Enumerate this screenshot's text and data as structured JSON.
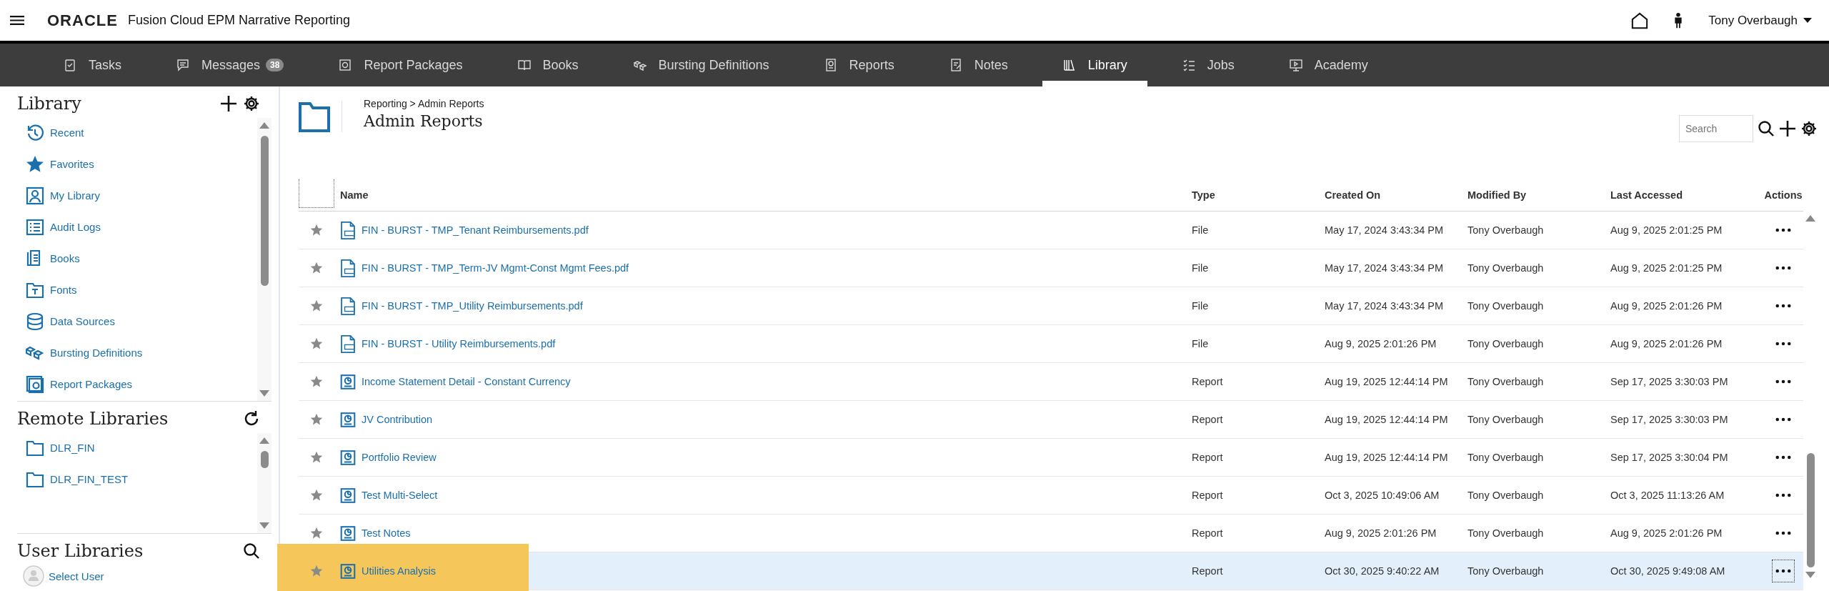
{
  "header": {
    "brand": "ORACLE",
    "product": "Fusion Cloud EPM Narrative Reporting",
    "user": "Tony Overbaugh"
  },
  "nav_tabs": [
    {
      "label": "Tasks",
      "selected": false
    },
    {
      "label": "Messages",
      "badge": "38",
      "selected": false
    },
    {
      "label": "Report Packages",
      "selected": false
    },
    {
      "label": "Books",
      "selected": false
    },
    {
      "label": "Bursting Definitions",
      "selected": false
    },
    {
      "label": "Reports",
      "selected": false
    },
    {
      "label": "Notes",
      "selected": false
    },
    {
      "label": "Library",
      "selected": true
    },
    {
      "label": "Jobs",
      "selected": false
    },
    {
      "label": "Academy",
      "selected": false
    }
  ],
  "sidebar": {
    "library_title": "Library",
    "items": [
      {
        "label": "Recent"
      },
      {
        "label": "Favorites"
      },
      {
        "label": "My Library"
      },
      {
        "label": "Audit Logs"
      },
      {
        "label": "Books"
      },
      {
        "label": "Fonts"
      },
      {
        "label": "Data Sources"
      },
      {
        "label": "Bursting Definitions"
      },
      {
        "label": "Report Packages"
      }
    ],
    "remote_title": "Remote Libraries",
    "remote_items": [
      {
        "label": "DLR_FIN"
      },
      {
        "label": "DLR_FIN_TEST"
      }
    ],
    "user_title": "User Libraries",
    "select_user": "Select User"
  },
  "content": {
    "breadcrumb": "Reporting > Admin Reports",
    "title": "Admin Reports",
    "search": {
      "placeholder": "Search"
    }
  },
  "table": {
    "columns": [
      "Name",
      "Type",
      "Created On",
      "Modified By",
      "Last Accessed",
      "Actions"
    ],
    "rows": [
      {
        "name": "FIN - BURST - TMP_Tenant Reimbursements.pdf",
        "kind": "pdf",
        "type": "File",
        "created": "May 17, 2024 3:43:34 PM",
        "modified_by": "Tony Overbaugh",
        "accessed": "Aug 9, 2025 2:01:25 PM",
        "selected": false,
        "highlighted": false
      },
      {
        "name": "FIN - BURST - TMP_Term-JV Mgmt-Const Mgmt Fees.pdf",
        "kind": "pdf",
        "type": "File",
        "created": "May 17, 2024 3:43:34 PM",
        "modified_by": "Tony Overbaugh",
        "accessed": "Aug 9, 2025 2:01:25 PM",
        "selected": false,
        "highlighted": false
      },
      {
        "name": "FIN - BURST - TMP_Utility Reimbursements.pdf",
        "kind": "pdf",
        "type": "File",
        "created": "May 17, 2024 3:43:34 PM",
        "modified_by": "Tony Overbaugh",
        "accessed": "Aug 9, 2025 2:01:26 PM",
        "selected": false,
        "highlighted": false
      },
      {
        "name": "FIN - BURST - Utility Reimbursements.pdf",
        "kind": "pdf",
        "type": "File",
        "created": "Aug 9, 2025 2:01:26 PM",
        "modified_by": "Tony Overbaugh",
        "accessed": "Aug 9, 2025 2:01:26 PM",
        "selected": false,
        "highlighted": false
      },
      {
        "name": "Income Statement Detail - Constant Currency",
        "kind": "report",
        "type": "Report",
        "created": "Aug 19, 2025 12:44:14 PM",
        "modified_by": "Tony Overbaugh",
        "accessed": "Sep 17, 2025 3:30:03 PM",
        "selected": false,
        "highlighted": false
      },
      {
        "name": "JV Contribution",
        "kind": "report",
        "type": "Report",
        "created": "Aug 19, 2025 12:44:14 PM",
        "modified_by": "Tony Overbaugh",
        "accessed": "Sep 17, 2025 3:30:03 PM",
        "selected": false,
        "highlighted": false
      },
      {
        "name": "Portfolio Review",
        "kind": "report",
        "type": "Report",
        "created": "Aug 19, 2025 12:44:14 PM",
        "modified_by": "Tony Overbaugh",
        "accessed": "Sep 17, 2025 3:30:04 PM",
        "selected": false,
        "highlighted": false
      },
      {
        "name": "Test Multi-Select",
        "kind": "report",
        "type": "Report",
        "created": "Oct 3, 2025 10:49:06 AM",
        "modified_by": "Tony Overbaugh",
        "accessed": "Oct 3, 2025 11:13:26 AM",
        "selected": false,
        "highlighted": false
      },
      {
        "name": "Test Notes",
        "kind": "report",
        "type": "Report",
        "created": "Aug 9, 2025 2:01:26 PM",
        "modified_by": "Tony Overbaugh",
        "accessed": "Aug 9, 2025 2:01:26 PM",
        "selected": false,
        "highlighted": false
      },
      {
        "name": "Utilities Analysis",
        "kind": "report",
        "type": "Report",
        "created": "Oct 30, 2025 9:40:22 AM",
        "modified_by": "Tony Overbaugh",
        "accessed": "Oct 30, 2025 9:49:08 AM",
        "selected": true,
        "highlighted": true
      }
    ]
  }
}
